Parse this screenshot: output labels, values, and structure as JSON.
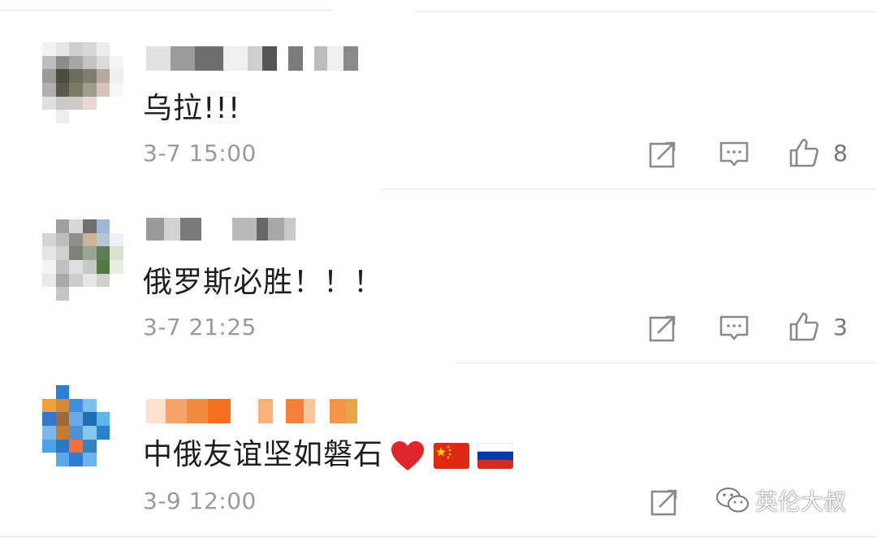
{
  "comments": [
    {
      "text": "乌拉!!!",
      "time": "3-7 15:00",
      "likes": "8"
    },
    {
      "text": "俄罗斯必胜！！！",
      "time": "3-7 21:25",
      "likes": "3"
    },
    {
      "text": "中俄友谊坚如磐石",
      "time": "3-9 12:00",
      "likes": ""
    }
  ],
  "icons": {
    "forward": "share-square-icon",
    "reply": "comment-bubble-icon",
    "like": "thumbs-up-icon",
    "heart": "red-heart-emoji",
    "china_flag": "china-flag-emoji",
    "russia_flag": "russia-flag-emoji"
  },
  "watermark": {
    "text": "英伦大叔"
  },
  "colors": {
    "text": "#1e1e1e",
    "meta": "#9a9a9a",
    "icon": "#8a8a8a",
    "heart": "#e0242b"
  }
}
